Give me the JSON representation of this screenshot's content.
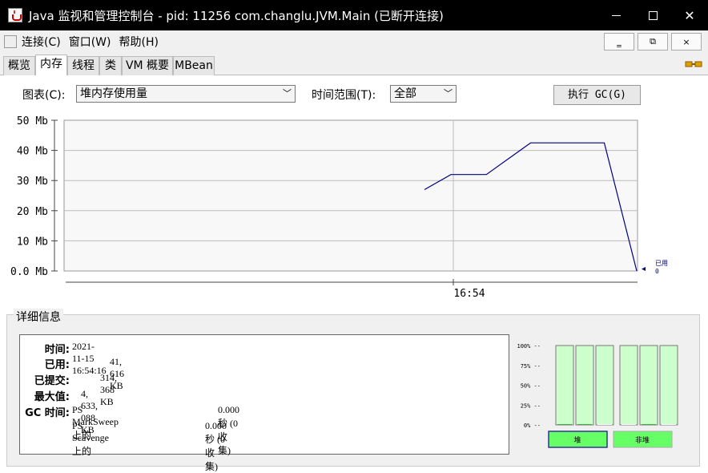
{
  "window": {
    "title": "Java 监视和管理控制台 - pid: 11256 com.changlu.JVM.Main (已断开连接)",
    "minimize": "—",
    "maximize": "□",
    "close": "✕"
  },
  "menu": {
    "items": [
      "连接(C)",
      "窗口(W)",
      "帮助(H)"
    ],
    "mdi": {
      "minimize": "‗",
      "restore": "⧉",
      "close": "×"
    }
  },
  "tabs": [
    "概览",
    "内存",
    "线程",
    "类",
    "VM 概要",
    "MBean"
  ],
  "active_tab": "内存",
  "controls": {
    "chart_label": "图表(C):",
    "chart_value": "堆内存使用量",
    "range_label": "时间范围(T):",
    "range_value": "全部",
    "gc_button": "执行 GC(G)"
  },
  "chart_data": {
    "type": "line",
    "y_ticks": [
      "50 Mb",
      "40 Mb",
      "30 Mb",
      "20 Mb",
      "10 Mb",
      "0.0 Mb"
    ],
    "ylim": [
      0,
      50
    ],
    "x_tick": "16:54",
    "series": [
      {
        "name": "已用",
        "color": "#000080",
        "points": [
          [
            0.0,
            27
          ],
          [
            0.09,
            32
          ],
          [
            0.21,
            32
          ],
          [
            0.36,
            42.5
          ],
          [
            0.61,
            42.5
          ],
          [
            0.72,
            0
          ]
        ]
      }
    ],
    "legend_label": "已用",
    "legend_value": "0"
  },
  "details": {
    "title": "详细信息",
    "rows": [
      {
        "key": "时间:",
        "value": "2021-11-15 16:54:16"
      },
      {
        "key": "已用:",
        "value": "41, 616 KB"
      },
      {
        "key": "已提交:",
        "value": "314, 368 KB"
      },
      {
        "key": "最大值:",
        "value": "4, 633, 088 KB"
      },
      {
        "key": "GC 时间:",
        "value": "PS MarkSweep上的",
        "value2": "0.000 秒 (0收集)"
      },
      {
        "key": "",
        "value": "PS Scavenge上的",
        "value2": "0.000 秒 (0收集)"
      }
    ]
  },
  "pool_bars": {
    "pct_ticks": [
      "100%",
      "75%",
      "50%",
      "25%",
      "0%"
    ],
    "heap_label": "堆",
    "nonheap_label": "非堆",
    "heap_fill": [
      0.01,
      0.01,
      0.0
    ],
    "nonheap_fill": [
      0.0,
      0.01,
      0.0
    ],
    "colors": {
      "bar_bg": "#ccffcc",
      "bar_border": "#66bb66",
      "label_bg": "#66ff66"
    }
  }
}
